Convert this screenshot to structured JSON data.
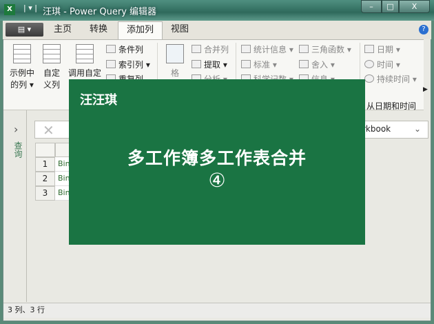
{
  "window": {
    "title": "汪琪 - Power Query 编辑器",
    "minimize": "–",
    "maximize": "□",
    "close": "X"
  },
  "tabs": [
    {
      "label": "主页"
    },
    {
      "label": "转换"
    },
    {
      "label": "添加列"
    },
    {
      "label": "视图"
    }
  ],
  "ribbon": {
    "from_example": "示例中的列",
    "custom_column": "自定义列",
    "invoke_custom": "调用自定",
    "conditional": "条件列",
    "index": "索引列",
    "duplicate": "重复列",
    "format": "格",
    "merge": "合并列",
    "extract": "提取",
    "parse": "分析",
    "statistics": "统计信息",
    "standard": "标准",
    "scientific": "科学记数",
    "trig": "三角函数",
    "rounding": "舍入",
    "information": "信息",
    "date": "日期",
    "time": "时间",
    "duration": "持续时间",
    "group_label": "从日期和时间"
  },
  "nav": {
    "label": "查询"
  },
  "formula": {
    "value": "rkbook"
  },
  "grid": {
    "rows": [
      {
        "n": "1",
        "v": "Bin"
      },
      {
        "n": "2",
        "v": "Bin"
      },
      {
        "n": "3",
        "v": "Bin"
      }
    ]
  },
  "overlay": {
    "name": "汪汪琪",
    "title": "多工作簿多工作表合并",
    "number": "④",
    "bg": "#1a7443"
  },
  "status": {
    "text": "3 列、3 行"
  }
}
